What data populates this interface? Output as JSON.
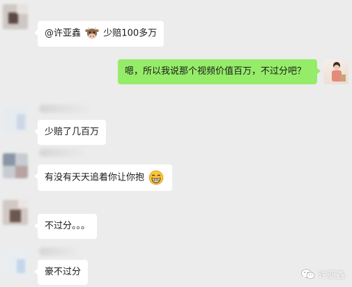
{
  "messages": [
    {
      "text_before": "@许亚鑫",
      "emoji": "cow-face-icon",
      "text_after": "少赔100多万"
    },
    {
      "text": "嗯，所以我说那个视频价值百万，不过分吧？"
    },
    {
      "text": "少赔了几百万"
    },
    {
      "text": "有没有天天追着你让你抱",
      "emoji": "grinning-face-icon"
    },
    {
      "text": "不过分。。。"
    },
    {
      "text": "豪不过分"
    }
  ],
  "watermark": {
    "text": "许亚鑫"
  },
  "colors": {
    "background": "#ececec",
    "incoming_bubble": "#ffffff",
    "outgoing_bubble": "#95ec69"
  }
}
